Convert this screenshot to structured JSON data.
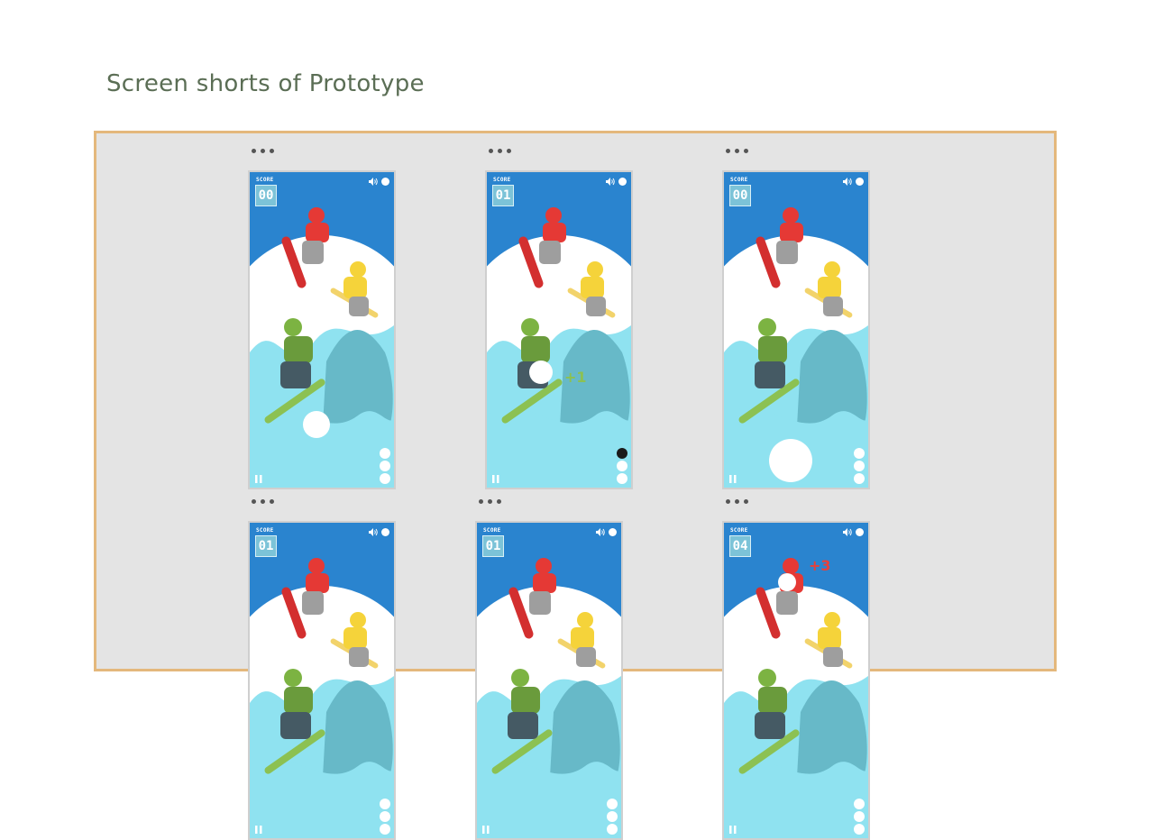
{
  "page": {
    "title": "Screen shorts of Prototype"
  },
  "colors": {
    "sky": "#2a84cf",
    "snow_light": "#8fe2f0",
    "accent_border": "#e4b87c",
    "title_text": "#5b6e55"
  },
  "screens": [
    {
      "score_label": "SCORE",
      "score": "00",
      "floater": "",
      "lives_used": 0,
      "snowball": "small"
    },
    {
      "score_label": "SCORE",
      "score": "01",
      "floater": "+1",
      "floater_color": "#8cc152",
      "lives_used": 1,
      "snowball": "held"
    },
    {
      "score_label": "SCORE",
      "score": "00",
      "floater": "",
      "lives_used": 0,
      "snowball": "large"
    },
    {
      "score_label": "SCORE",
      "score": "01",
      "floater": "",
      "lives_used": 0,
      "snowball": "none"
    },
    {
      "score_label": "SCORE",
      "score": "01",
      "floater": "",
      "lives_used": 0,
      "snowball": "none"
    },
    {
      "score_label": "SCORE",
      "score": "04",
      "floater": "+3",
      "floater_color": "#e8403a",
      "lives_used": 0,
      "snowball": "head"
    }
  ],
  "icons": {
    "frame_menu": "more-dots-icon",
    "sound": "speaker-icon",
    "menu": "menu-icon",
    "pause": "pause-icon",
    "life": "life-icon"
  }
}
